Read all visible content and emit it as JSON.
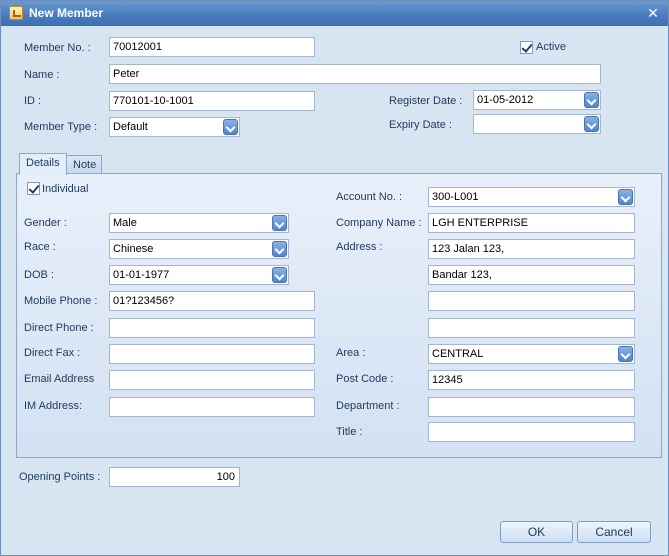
{
  "window": {
    "title": "New Member",
    "close_glyph": "✕"
  },
  "header": {
    "member_no": {
      "label": "Member No. :",
      "value": "70012001"
    },
    "active": {
      "label": "Active",
      "checked": true
    },
    "name": {
      "label": "Name :",
      "value": "Peter"
    },
    "id": {
      "label": "ID :",
      "value": "770101-10-1001"
    },
    "register_date": {
      "label": "Register Date :",
      "value": "01-05-2012"
    },
    "member_type": {
      "label": "Member Type :",
      "value": "Default"
    },
    "expiry_date": {
      "label": "Expiry Date :",
      "value": ""
    }
  },
  "tabs": [
    {
      "label": "Details",
      "selected": true
    },
    {
      "label": "Note",
      "selected": false
    }
  ],
  "details": {
    "individual": {
      "label": "Individual",
      "checked": true
    },
    "gender": {
      "label": "Gender :",
      "value": "Male"
    },
    "race": {
      "label": "Race :",
      "value": "Chinese"
    },
    "dob": {
      "label": "DOB :",
      "value": "01-01-1977"
    },
    "mobile_phone": {
      "label": "Mobile Phone :",
      "value": "01?123456?"
    },
    "direct_phone": {
      "label": "Direct Phone :",
      "value": ""
    },
    "direct_fax": {
      "label": "Direct Fax :",
      "value": ""
    },
    "email_address": {
      "label": "Email Address",
      "value": ""
    },
    "im_address": {
      "label": "IM Address:",
      "value": ""
    },
    "account_no": {
      "label": "Account No. :",
      "value": "300-L001"
    },
    "company_name": {
      "label": "Company Name :",
      "value": "LGH ENTERPRISE"
    },
    "address": {
      "label": "Address :",
      "lines": [
        "123 Jalan 123,",
        "Bandar 123,",
        "",
        ""
      ]
    },
    "area": {
      "label": "Area :",
      "value": "CENTRAL"
    },
    "post_code": {
      "label": "Post Code :",
      "value": "12345"
    },
    "department": {
      "label": "Department :",
      "value": ""
    },
    "title": {
      "label": "Title :",
      "value": ""
    }
  },
  "opening_points": {
    "label": "Opening Points :",
    "value": "100"
  },
  "buttons": {
    "ok": "OK",
    "cancel": "Cancel"
  },
  "icons": {
    "app": "new-member-window-icon",
    "dropdown": "chevron-down-icon",
    "check": "checkmark-icon",
    "close": "close-icon"
  },
  "colors": {
    "titlebar": "#4a7cbf",
    "window_bg": "#d7e4f2",
    "label_text": "#1e395b",
    "field_border": "#a5b5cc"
  }
}
